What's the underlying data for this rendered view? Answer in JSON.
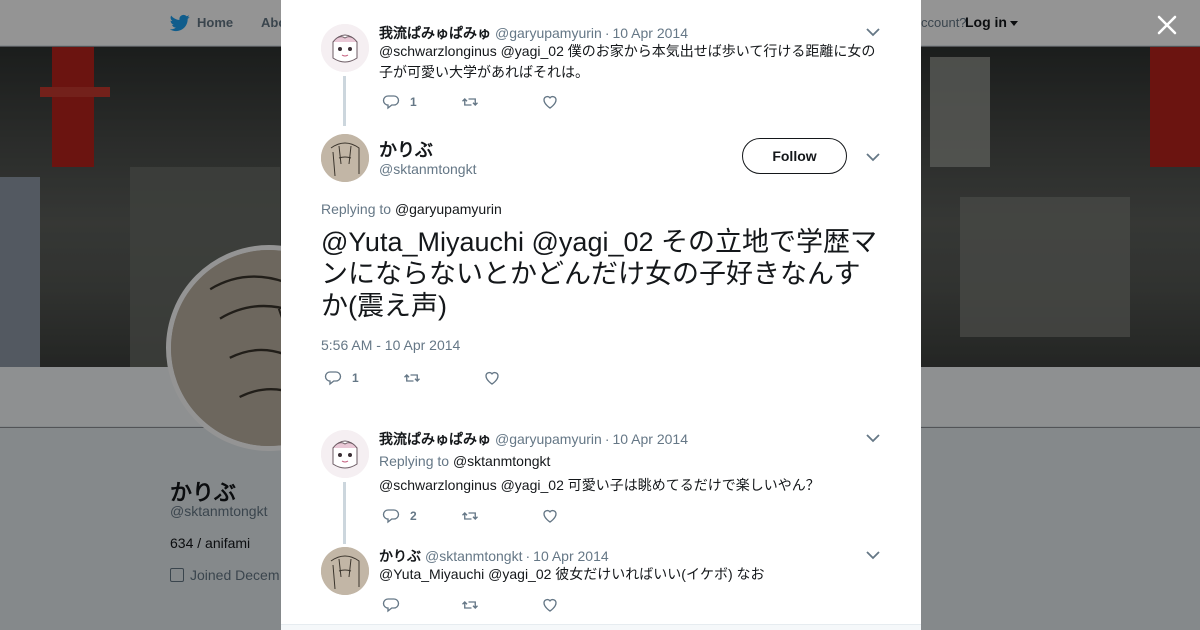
{
  "nav": {
    "home_label": "Home",
    "about_label": "Abo",
    "account_text": "ccount?",
    "login_label": "Log in"
  },
  "profile": {
    "name": "かりぶ",
    "handle": "@sktanmtongkt",
    "bio": "634 / anifami",
    "joined": "Joined Decem"
  },
  "colors": {
    "twitter_blue": "#1da1f2",
    "text_primary": "#14171a",
    "text_secondary": "#657786",
    "thread_line": "#ccd6dd"
  },
  "icons": {
    "bird": "twitter-bird-icon",
    "close": "close-icon",
    "reply": "reply-icon",
    "retweet": "retweet-icon",
    "like": "heart-icon",
    "more": "chevron-down-icon",
    "calendar": "calendar-icon"
  },
  "tweets": {
    "t1": {
      "name": "我流ぱみゅぱみゅ",
      "handle": "@garyupamyurin",
      "date": "10 Apr 2014",
      "text": "@schwarzlonginus @yagi_02 僕のお家から本気出せば歩いて行ける距離に女の子が可愛い大学があればそれは。",
      "reply_count": "1"
    },
    "focus": {
      "name": "かりぶ",
      "handle": "@sktanmtongkt",
      "follow_label": "Follow",
      "replying_label": "Replying to",
      "replying_to": "@garyupamyurin",
      "text": "@Yuta_Miyauchi @yagi_02 その立地で学歴マンにならないとかどんだけ女の子好きなんすか(震え声)",
      "timestamp": "5:56 AM - 10 Apr 2014",
      "reply_count": "1"
    },
    "t3": {
      "name": "我流ぱみゅぱみゅ",
      "handle": "@garyupamyurin",
      "date": "10 Apr 2014",
      "replying_label": "Replying to",
      "replying_to": "@sktanmtongkt",
      "text": "@schwarzlonginus @yagi_02 可愛い子は眺めてるだけで楽しいやん？",
      "reply_count": "2"
    },
    "t4": {
      "name": "かりぶ",
      "handle": "@sktanmtongkt",
      "date": "10 Apr 2014",
      "text": "@Yuta_Miyauchi @yagi_02 彼女だけいればいい(イケボ) なお"
    }
  }
}
